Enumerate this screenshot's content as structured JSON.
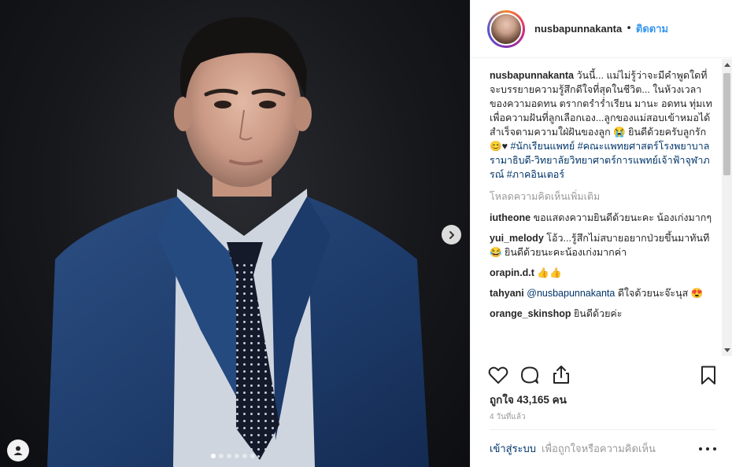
{
  "post": {
    "username": "nusbapunnakanta",
    "separator": "•",
    "follow_label": "ติดตาม",
    "caption": {
      "username": "nusbapunnakanta",
      "text": " วันนี้... แม่ไม่รู้ว่าจะมีคำพูดใดที่จะบรรยายความรู้สึกดีใจที่สุดในชีวิต... ในห้วงเวลาของความอดทน ตรากตรำร่ำเรียน มานะ อดทน ทุ่มเทเพื่อความฝันที่ลูกเลือกเอง...ลูกของแม่สอบเข้าหมอได้สำเร็จตามความใฝ่ฝันของลูก 😭 ยินดีด้วยครับลูกรัก😊♥ ",
      "hashtags": [
        "#นักเรียนแพทย์",
        "#คณะแพทยศาสตร์โรงพยาบาลรามาธิบดี-วิทยาลัยวิทยาศาตร์การแพทย์เจ้าฟ้าจุฬาภรณ์",
        "#ภาคอินเตอร์"
      ]
    },
    "load_more_label": "โหลดความคิดเห็นเพิ่มเติม",
    "comments": [
      {
        "user": "iutheone",
        "text": " ขอแสดงความยินดีด้วยนะคะ น้องเก่งมากๆ"
      },
      {
        "user": "yui_melody",
        "text": " โอ้ว...รู้สึกไม่สบายอยากป่วยขึ้นมาทันที 😂 ยินดีด้วยนะคะน้องเก่งมากค่า"
      },
      {
        "user": "orapin.d.t",
        "text": " 👍👍"
      },
      {
        "user": "tahyani",
        "mention": "@nusbapunnakanta",
        "text": " ดีใจด้วยนะจ๊ะนุส 😍"
      },
      {
        "user": "orange_skinshop",
        "text": " ยินดีด้วยค่ะ"
      }
    ],
    "likes_text": "ถูกใจ 43,165 คน",
    "time_ago": "4 วันที่แล้ว",
    "login_label": "เข้าสู่ระบบ",
    "login_rest": "เพื่อถูกใจหรือความคิดเห็น",
    "carousel": {
      "count": 6,
      "active_index": 0
    }
  },
  "icons": {
    "like": "heart-icon",
    "comment": "comment-icon",
    "share": "share-icon",
    "save": "bookmark-icon",
    "next": "chevron-right-icon",
    "tag": "user-tag-icon",
    "more": "more-options-icon"
  },
  "colors": {
    "link": "#3897f0",
    "hashtag": "#003569",
    "muted": "#999999",
    "suit": "#1f3e6e"
  }
}
